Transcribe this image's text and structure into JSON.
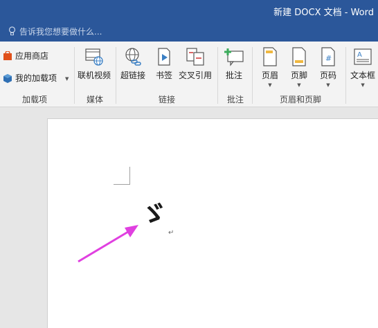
{
  "window": {
    "title": "新建 DOCX 文档 - Word"
  },
  "tell_me": {
    "placeholder": "告诉我您想要做什么..."
  },
  "ribbon": {
    "addins": {
      "store_label": "应用商店",
      "myaddins_label": "我的加载项",
      "group_label": "加载项"
    },
    "media": {
      "online_video_label": "联机视频",
      "group_label": "媒体"
    },
    "links": {
      "hyperlink_label": "超链接",
      "bookmark_label": "书签",
      "crossref_label": "交叉引用",
      "group_label": "链接"
    },
    "comments": {
      "comment_label": "批注",
      "group_label": "批注"
    },
    "header_footer": {
      "header_label": "页眉",
      "footer_label": "页脚",
      "page_number_label": "页码",
      "group_label": "页眉和页脚"
    },
    "text": {
      "textbox_label": "文本框"
    }
  },
  "document": {
    "content_char": "ゞ",
    "paragraph_mark": "↵"
  },
  "colors": {
    "title_bar": "#2b579a",
    "arrow": "#e040e0",
    "store_icon": "#e0501a"
  }
}
